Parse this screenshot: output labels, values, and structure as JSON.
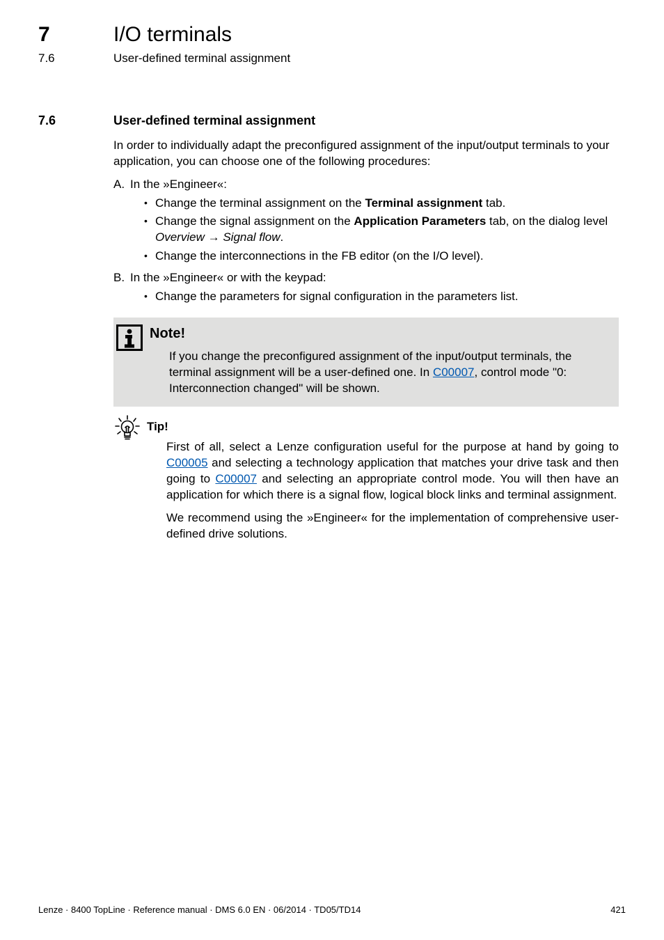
{
  "header": {
    "chapter_num": "7",
    "chapter_title": "I/O terminals",
    "section_num_top": "7.6",
    "section_title_top": "User-defined terminal assignment"
  },
  "dashes": "_ _ _ _ _ _ _ _ _ _ _ _ _ _ _ _ _ _ _ _ _ _ _ _ _ _ _ _ _ _ _ _ _ _ _ _ _ _ _ _ _ _ _ _ _ _ _ _ _ _ _ _ _ _ _ _ _ _ _ _ _ _ _ _",
  "section": {
    "num": "7.6",
    "title": "User-defined terminal assignment"
  },
  "intro": "In order to individually adapt the preconfigured assignment of the input/output terminals to your application, you can choose one of the following procedures:",
  "listA": {
    "marker": "A.",
    "label": "In the »Engineer«:",
    "items": [
      {
        "pre": "Change the terminal assignment on the ",
        "bold": "Terminal assignment",
        "post": " tab."
      },
      {
        "pre": "Change the signal assignment on the ",
        "bold": "Application Parameters",
        "post": " tab, on the dialog level ",
        "italic_a": "Overview",
        "arrow": "→",
        "italic_b": "Signal flow",
        "end": "."
      },
      {
        "pre": "Change the interconnections in the FB editor (on the I/O level)."
      }
    ]
  },
  "listB": {
    "marker": "B.",
    "label": "In the »Engineer« or with the keypad:",
    "items": [
      {
        "pre": "Change the parameters for signal configuration in the parameters list."
      }
    ]
  },
  "note": {
    "title": "Note!",
    "text_pre": "If you change the preconfigured assignment of the input/output terminals, the terminal assignment will be a user-defined one. In ",
    "link": "C00007",
    "text_post": ", control mode \"0: Interconnection changed\" will be shown."
  },
  "tip": {
    "title": "Tip!",
    "p1_a": "First of all, select a Lenze configuration useful for the purpose at hand by going to ",
    "p1_link1": "C00005",
    "p1_b": " and selecting a technology application that matches your drive task and then going to ",
    "p1_link2": "C00007",
    "p1_c": " and selecting an appropriate control mode. You will then have an application for which there is a signal flow, logical block links and terminal assignment.",
    "p2": "We recommend using the »Engineer« for the implementation of comprehensive user-defined drive solutions."
  },
  "footer": {
    "left": "Lenze · 8400 TopLine · Reference manual · DMS 6.0 EN · 06/2014 · TD05/TD14",
    "right": "421"
  }
}
